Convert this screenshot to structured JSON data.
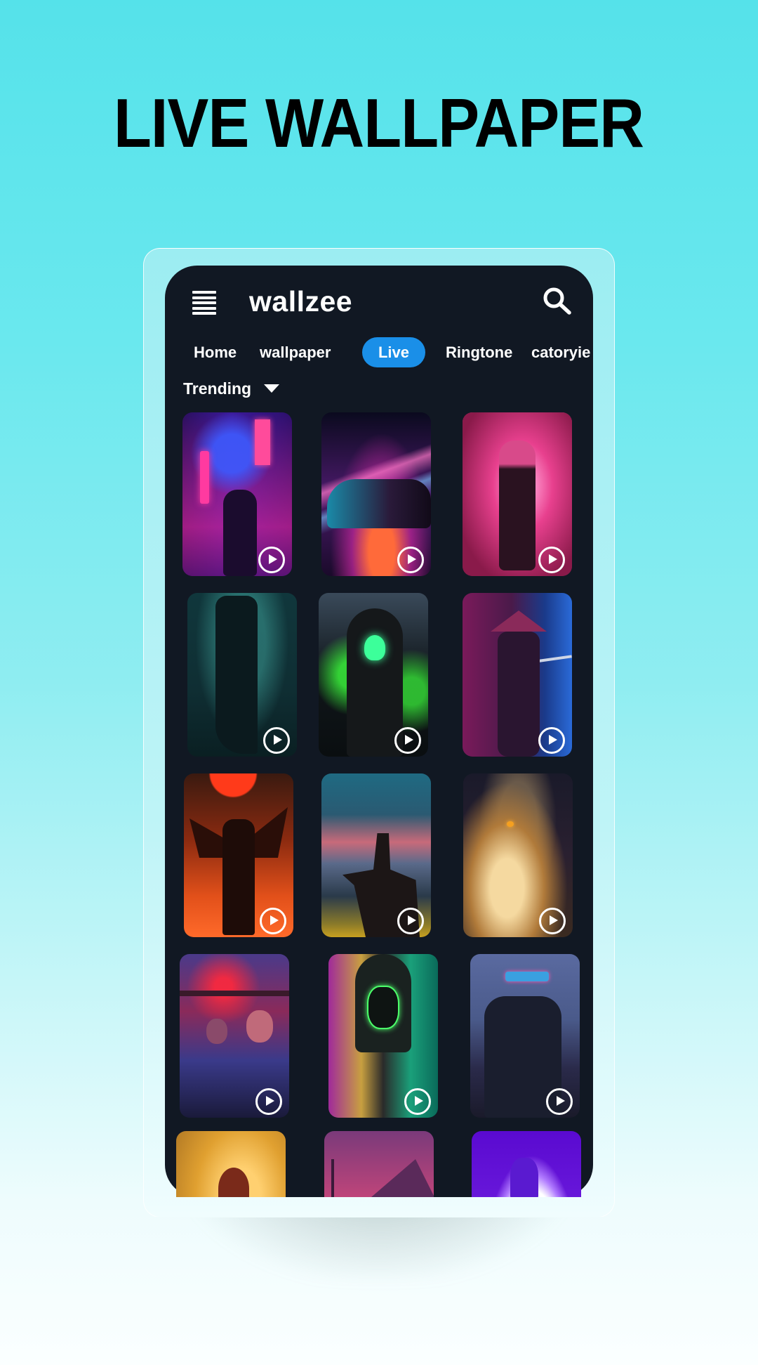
{
  "headline": "LIVE WALLPAPER",
  "app": {
    "brand": "wallzee",
    "icons": {
      "menu": "hamburger-menu-icon",
      "search": "search-icon",
      "filter_caret": "caret-down-icon",
      "play": "play-circle-icon"
    },
    "colors": {
      "background": "#111823",
      "accent": "#1a8fe8",
      "text": "#ffffff",
      "page_top": "#55e2ea",
      "page_bottom": "#fbffff"
    }
  },
  "tabs": [
    {
      "label": "Home",
      "active": false
    },
    {
      "label": "wallpaper",
      "active": false
    },
    {
      "label": "Live",
      "active": true
    },
    {
      "label": "Ringtone",
      "active": false
    },
    {
      "label": "catoryie",
      "active": false
    }
  ],
  "filter": {
    "selected": "Trending"
  },
  "wallpapers": [
    {
      "subject": "neon cyberpunk alley figure",
      "live": true
    },
    {
      "subject": "neon sports car",
      "live": true
    },
    {
      "subject": "pink super saiyan warrior",
      "live": true
    },
    {
      "subject": "woman on rooftop over city",
      "live": true
    },
    {
      "subject": "green flame grim reaper",
      "live": true
    },
    {
      "subject": "samurai with katana in smoke",
      "live": true
    },
    {
      "subject": "winged samurai in fire",
      "live": true
    },
    {
      "subject": "rider on horse at sunset",
      "live": true
    },
    {
      "subject": "glowing cat portrait",
      "live": true
    },
    {
      "subject": "neon group poster",
      "live": true
    },
    {
      "subject": "hooded figure with neon mask",
      "live": true
    },
    {
      "subject": "cyberpunk girl with visor",
      "live": true
    },
    {
      "subject": "hero against golden sky",
      "live": false
    },
    {
      "subject": "synthwave mountain sunset",
      "live": false
    },
    {
      "subject": "silhouette against purple moon",
      "live": false
    }
  ]
}
